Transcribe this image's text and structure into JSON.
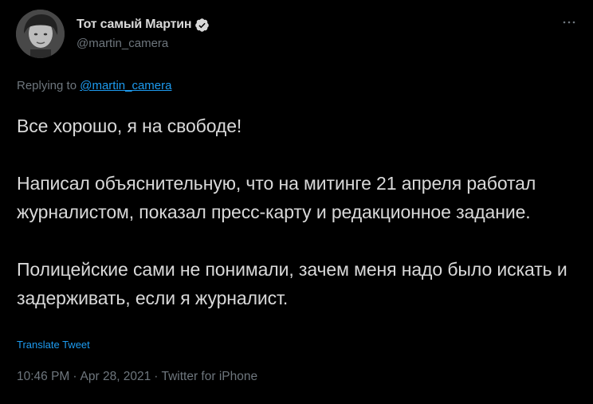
{
  "colors": {
    "background": "#000000",
    "text": "#d9d9d9",
    "secondary": "#6e767d",
    "accent": "#1d9bf0"
  },
  "author": {
    "display_name": "Тот самый Мартин",
    "handle": "@martin_camera",
    "verified_icon": "verified-badge-icon"
  },
  "more_menu_icon": "more-horizontal-icon",
  "reply_context": {
    "prefix": "Replying to",
    "handle": "@martin_camera"
  },
  "tweet": {
    "paragraphs": [
      "Все хорошо, я на свободе!",
      "Написал объяснительную, что на митинге 21 апреля работал журналистом, показал пресс-карту и редакционное задание.",
      "Полицейские сами не понимали, зачем меня надо было искать и задерживать, если я журналист."
    ],
    "translate_label": "Translate Tweet"
  },
  "meta": {
    "time": "10:46 PM",
    "separator": "·",
    "date": "Apr 28, 2021",
    "source": "Twitter for iPhone"
  }
}
